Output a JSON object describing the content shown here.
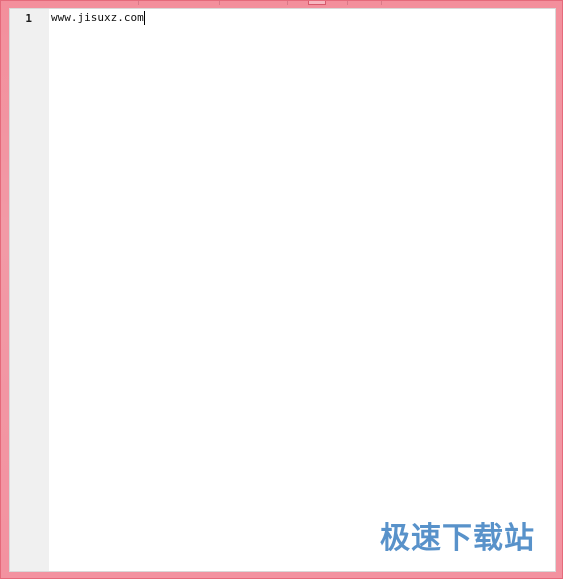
{
  "editor": {
    "lines": [
      {
        "number": "1",
        "text": "www.jisuxz.com"
      }
    ]
  },
  "watermark": {
    "text": "极速下载站"
  },
  "colors": {
    "frame": "#f392a0",
    "gutter": "#f0f0f0",
    "editor_bg": "#ffffff",
    "watermark": "#3c7fc1"
  },
  "icons": {
    "caret": "text-caret-icon"
  }
}
